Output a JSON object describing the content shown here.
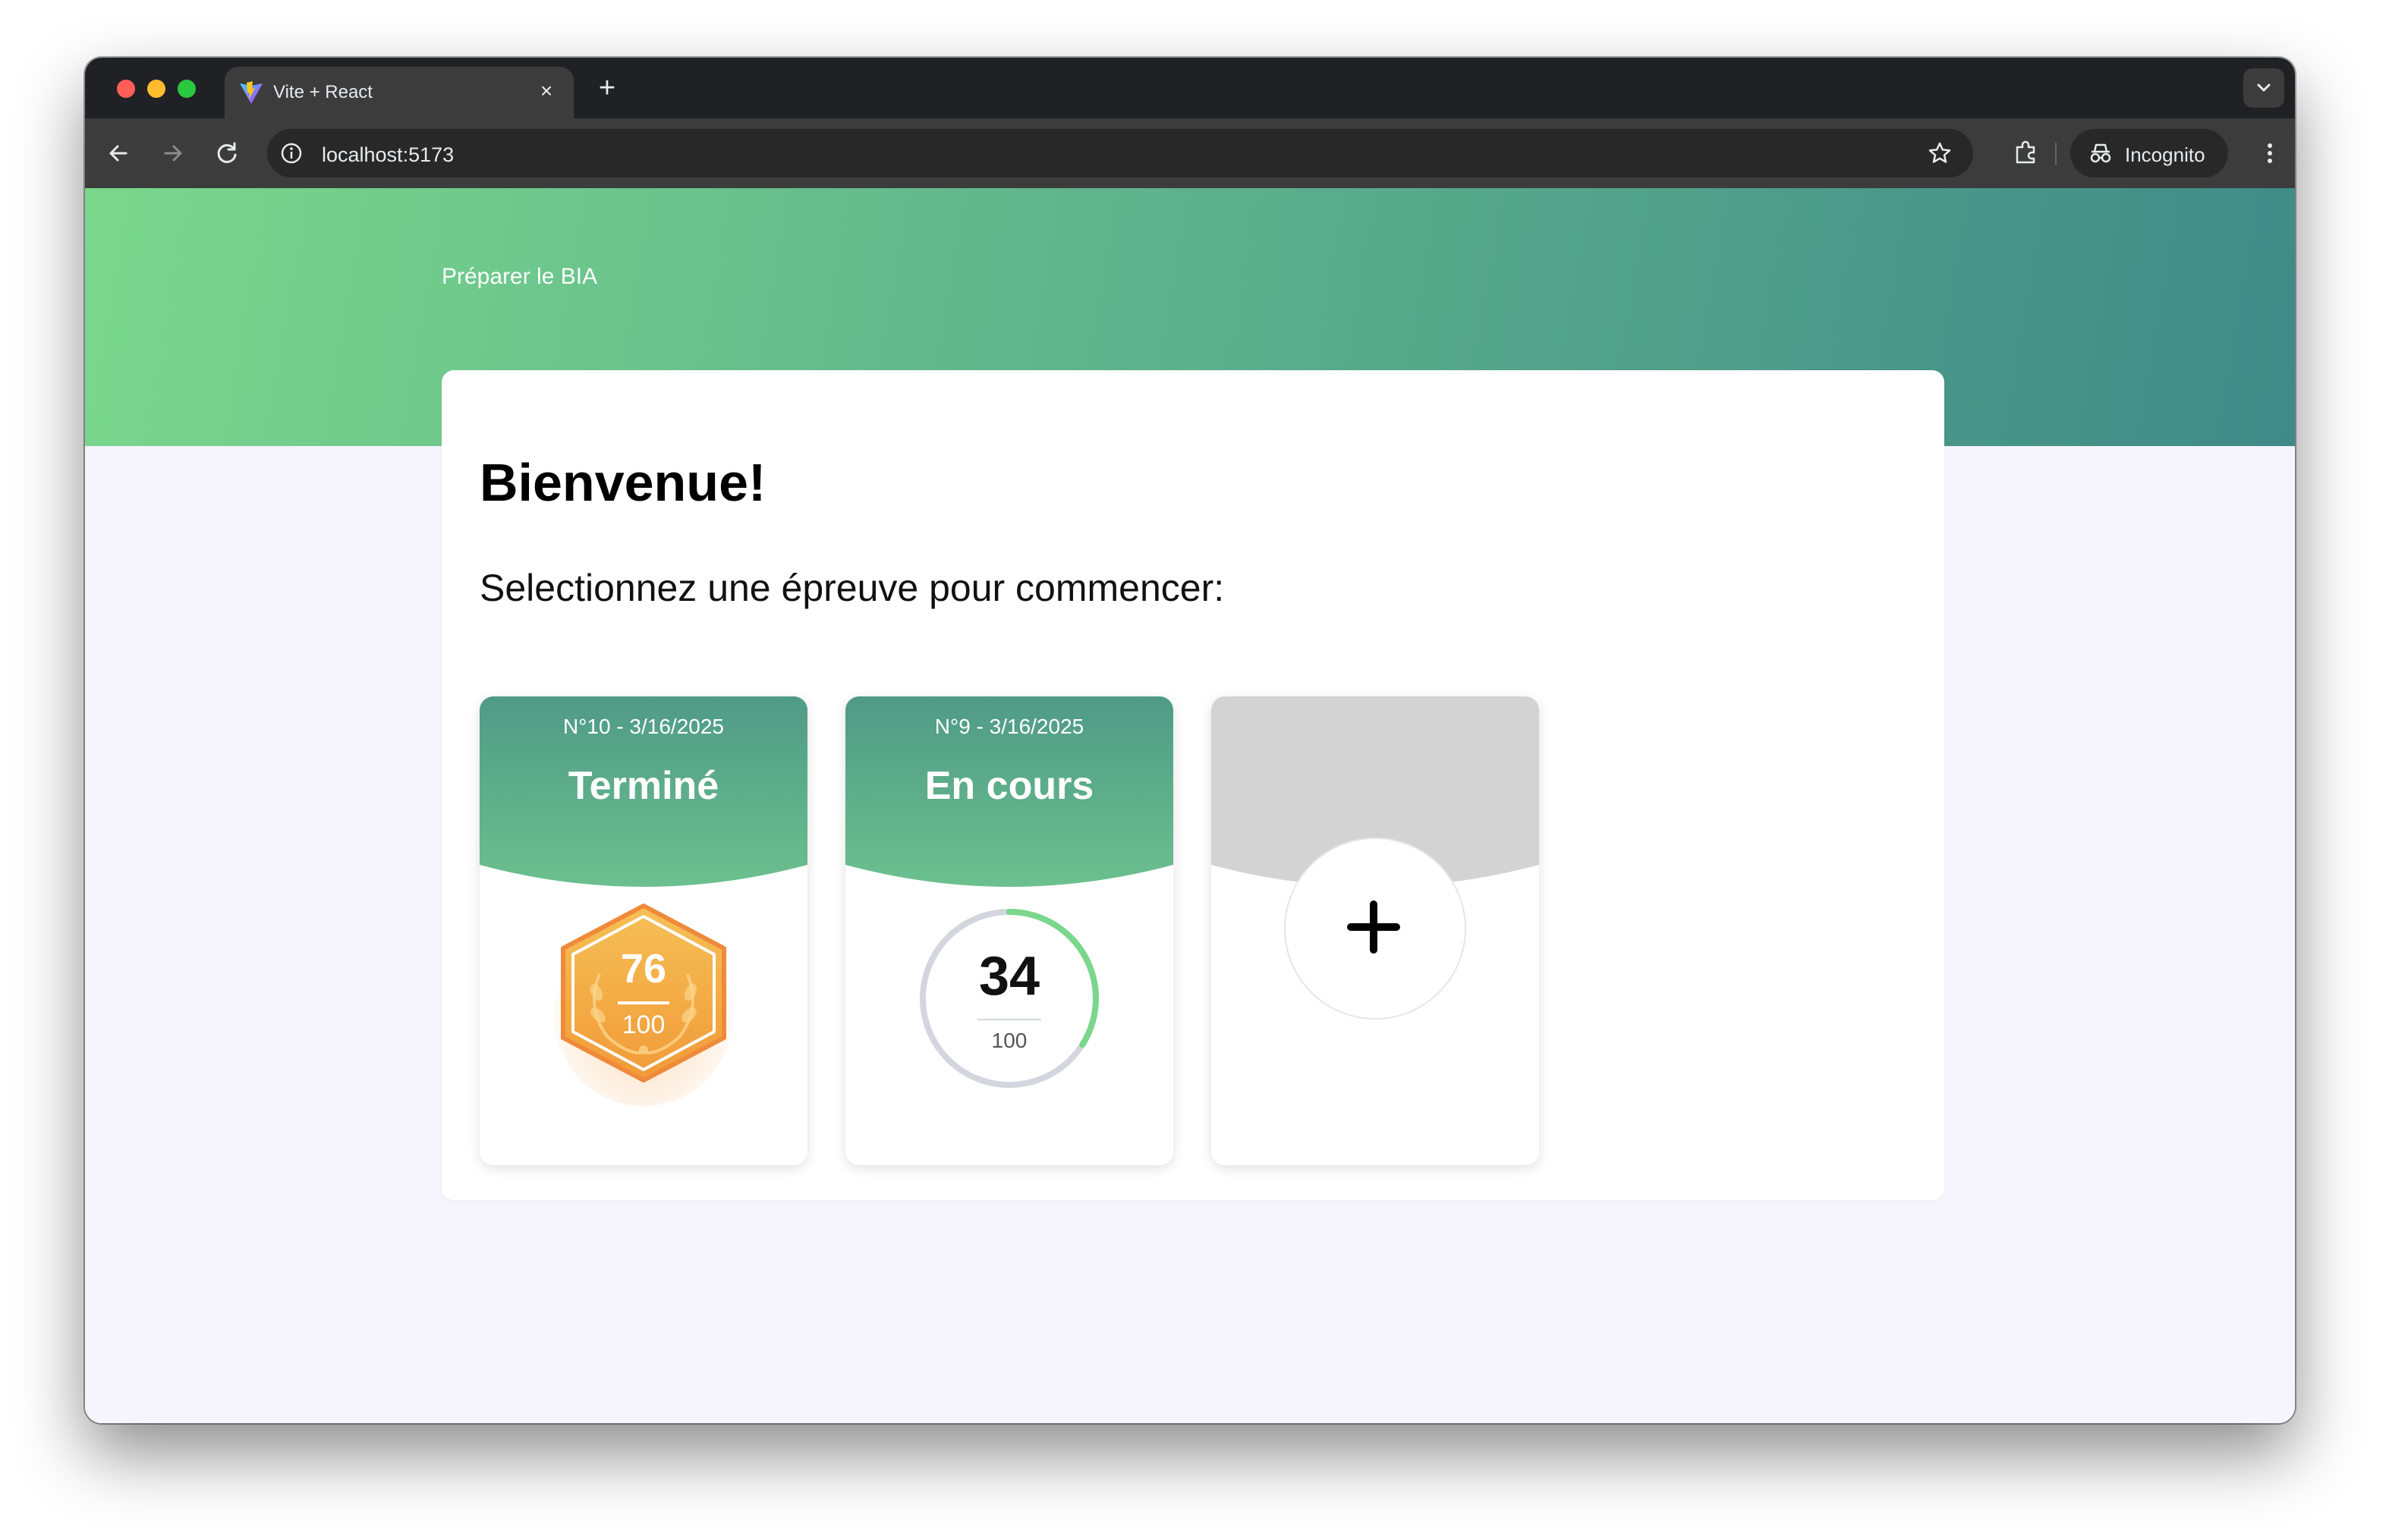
{
  "browser": {
    "tab_title": "Vite + React",
    "tab_close": "×",
    "new_tab": "+",
    "url": "localhost:5173",
    "incognito_label": "Incognito"
  },
  "page": {
    "brand": "Préparer le BIA",
    "welcome": "Bienvenue!",
    "subtitle": "Selectionnez une épreuve pour commencer:"
  },
  "exams": [
    {
      "meta": "N°10 - 3/16/2025",
      "status": "Terminé",
      "score": "76",
      "total": "100"
    },
    {
      "meta": "N°9 - 3/16/2025",
      "status": "En cours",
      "score": "34",
      "total": "100",
      "progress": 0.34
    }
  ],
  "new_exam": {
    "icon": "plus-icon"
  },
  "colors": {
    "accent_green": "#7ad78c",
    "accent_teal": "#3f8a87",
    "badge_orange": "#f2a43c",
    "page_bg": "#f6f5fd"
  }
}
